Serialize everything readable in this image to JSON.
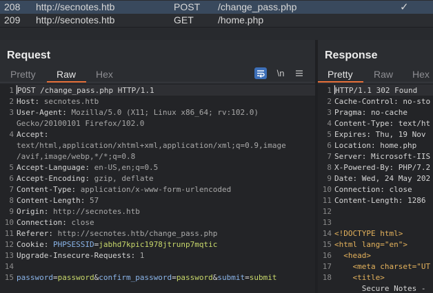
{
  "history": {
    "rows": [
      {
        "num": "208",
        "host": "http://secnotes.htb",
        "method": "POST",
        "url": "/change_pass.php",
        "check": "✓",
        "selected": true
      },
      {
        "num": "209",
        "host": "http://secnotes.htb",
        "method": "GET",
        "url": "/home.php",
        "check": "",
        "selected": false
      }
    ]
  },
  "request": {
    "title": "Request",
    "tabs": [
      "Pretty",
      "Raw",
      "Hex"
    ],
    "active_tab": "Raw",
    "tools": {
      "wrap_icon": "wrap-lines-icon",
      "newline_label": "\\n",
      "menu_icon": "hamburger-menu-icon"
    },
    "lines": [
      {
        "n": "1",
        "text": "POST /change_pass.php HTTP/1.1"
      },
      {
        "n": "2",
        "key": "Host:",
        "val": " secnotes.htb"
      },
      {
        "n": "3",
        "key": "User-Agent:",
        "val": " Mozilla/5.0 (X11; Linux x86_64; rv:102.0)"
      },
      {
        "n": "",
        "val": "Gecko/20100101 Firefox/102.0"
      },
      {
        "n": "4",
        "key": "Accept:",
        "val": ""
      },
      {
        "n": "",
        "val": "text/html,application/xhtml+xml,application/xml;q=0.9,image"
      },
      {
        "n": "",
        "val": "/avif,image/webp,*/*;q=0.8"
      },
      {
        "n": "5",
        "key": "Accept-Language:",
        "val": " en-US,en;q=0.5"
      },
      {
        "n": "6",
        "key": "Accept-Encoding:",
        "val": " gzip, deflate"
      },
      {
        "n": "7",
        "key": "Content-Type:",
        "val": " application/x-www-form-urlencoded"
      },
      {
        "n": "8",
        "key": "Content-Length:",
        "val": " 57"
      },
      {
        "n": "9",
        "key": "Origin:",
        "val": " http://secnotes.htb"
      },
      {
        "n": "10",
        "key": "Connection:",
        "val": " close"
      },
      {
        "n": "11",
        "key": "Referer:",
        "val": " http://secnotes.htb/change_pass.php"
      },
      {
        "n": "12",
        "key": "Cookie:",
        "val": " ",
        "cookie_name": "PHPSESSID",
        "cookie_eq": "=",
        "cookie_val": "jabhd7kpic1978jtrunp7mqtic"
      },
      {
        "n": "13",
        "key": "Upgrade-Insecure-Requests:",
        "val": " 1"
      },
      {
        "n": "14",
        "val": ""
      },
      {
        "n": "15",
        "body": [
          {
            "name": "password",
            "value": "password"
          },
          {
            "name": "confirm_password",
            "value": "password"
          },
          {
            "name": "submit",
            "value": "submit"
          }
        ]
      }
    ]
  },
  "response": {
    "title": "Response",
    "tabs": [
      "Pretty",
      "Raw",
      "Hex"
    ],
    "active_tab": "Pretty",
    "lines": [
      {
        "n": "1",
        "text": "HTTP/1.1 302 Found"
      },
      {
        "n": "2",
        "text": "Cache-Control: no-sto"
      },
      {
        "n": "3",
        "text": "Pragma: no-cache"
      },
      {
        "n": "4",
        "text": "Content-Type: text/ht"
      },
      {
        "n": "5",
        "text": "Expires: Thu, 19 Nov"
      },
      {
        "n": "6",
        "text": "Location: home.php"
      },
      {
        "n": "7",
        "text": "Server: Microsoft-IIS"
      },
      {
        "n": "8",
        "text": "X-Powered-By: PHP/7.2"
      },
      {
        "n": "9",
        "text": "Date: Wed, 24 May 202"
      },
      {
        "n": "10",
        "text": "Connection: close"
      },
      {
        "n": "11",
        "text": "Content-Length: 1286"
      },
      {
        "n": "12",
        "text": ""
      },
      {
        "n": "13",
        "text": ""
      },
      {
        "n": "14",
        "text": "<!DOCTYPE html>"
      },
      {
        "n": "15",
        "text": "<html lang=\"en\">"
      },
      {
        "n": "16",
        "text": "  <head>"
      },
      {
        "n": "17",
        "text": "    <meta charset=\"UT"
      },
      {
        "n": "18",
        "text": "    <title>"
      },
      {
        "n": "",
        "text": "      Secure Notes -"
      }
    ]
  },
  "colors": {
    "accent": "#e8703a",
    "selected_row": "#39495d",
    "param_name": "#8ab4e8",
    "param_value": "#c8d86b"
  }
}
